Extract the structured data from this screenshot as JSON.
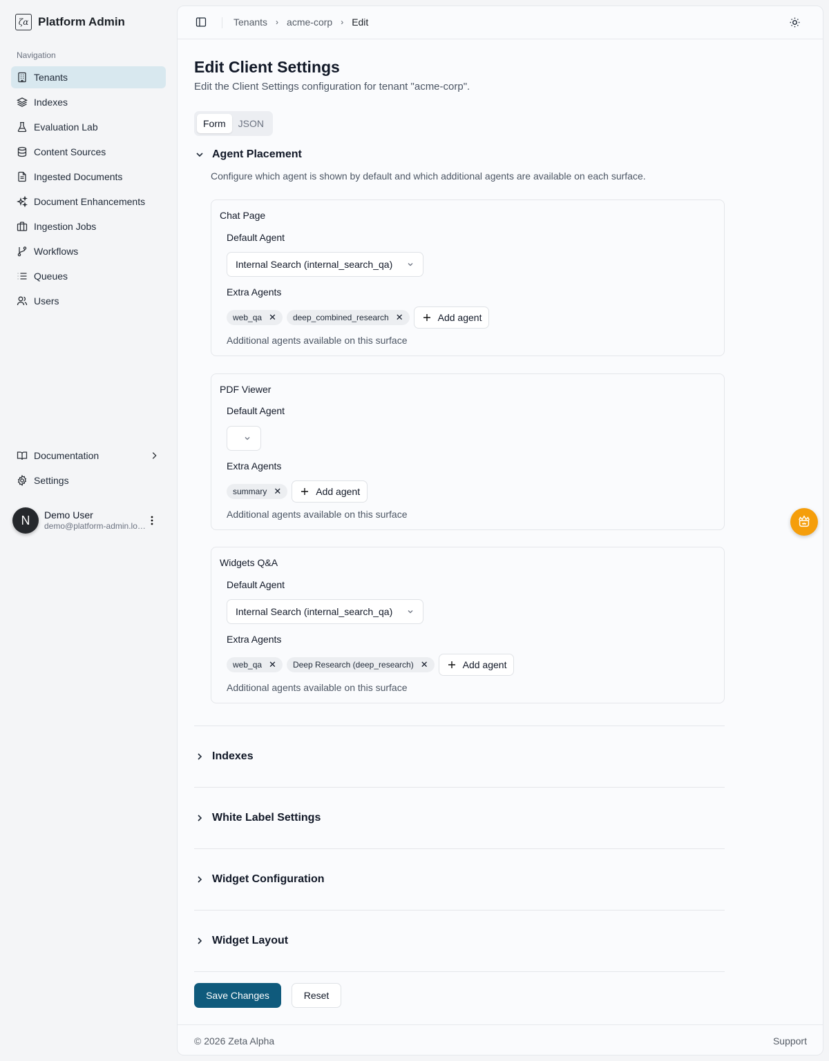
{
  "app": {
    "name": "Platform Admin"
  },
  "nav": {
    "caption": "Navigation",
    "items": [
      {
        "label": "Tenants",
        "icon": "building-icon"
      },
      {
        "label": "Indexes",
        "icon": "layers-icon"
      },
      {
        "label": "Evaluation Lab",
        "icon": "flask-icon"
      },
      {
        "label": "Content Sources",
        "icon": "database-icon"
      },
      {
        "label": "Ingested Documents",
        "icon": "file-text-icon"
      },
      {
        "label": "Document Enhancements",
        "icon": "sparkles-icon"
      },
      {
        "label": "Ingestion Jobs",
        "icon": "briefcase-icon"
      },
      {
        "label": "Workflows",
        "icon": "git-branch-icon"
      },
      {
        "label": "Queues",
        "icon": "list-icon"
      },
      {
        "label": "Users",
        "icon": "users-icon"
      }
    ],
    "active": "Tenants",
    "bottom": [
      {
        "label": "Documentation",
        "icon": "book-icon"
      },
      {
        "label": "Settings",
        "icon": "gear-icon"
      }
    ]
  },
  "user": {
    "initial": "N",
    "name": "Demo User",
    "email": "demo@platform-admin.local"
  },
  "breadcrumb": [
    "Tenants",
    "acme-corp",
    "Edit"
  ],
  "page": {
    "title": "Edit Client Settings",
    "subtitle": "Edit the Client Settings configuration for tenant \"acme-corp\".",
    "tabs": [
      "Form",
      "JSON"
    ],
    "active_tab": "Form"
  },
  "agent_placement": {
    "title": "Agent Placement",
    "description": "Configure which agent is shown by default and which additional agents are available on each surface.",
    "default_label": "Default Agent",
    "extra_label": "Extra Agents",
    "add_label": "Add agent",
    "hint": "Additional agents available on this surface",
    "surfaces": [
      {
        "title": "Chat Page",
        "default": "Internal Search (internal_search_qa)",
        "extras": [
          "web_qa",
          "deep_combined_research"
        ]
      },
      {
        "title": "PDF Viewer",
        "default": "",
        "extras": [
          "summary"
        ]
      },
      {
        "title": "Widgets Q&A",
        "default": "Internal Search (internal_search_qa)",
        "extras": [
          "web_qa",
          "Deep Research (deep_research)"
        ]
      }
    ]
  },
  "sections": [
    "Indexes",
    "White Label Settings",
    "Widget Configuration",
    "Widget Layout"
  ],
  "actions": {
    "save": "Save Changes",
    "reset": "Reset"
  },
  "footer": {
    "copyright": "© 2026 Zeta Alpha",
    "support": "Support"
  },
  "colors": {
    "primary": "#0f5a7c",
    "active_nav": "#d8e8ef",
    "fab": "#f59e0b"
  }
}
